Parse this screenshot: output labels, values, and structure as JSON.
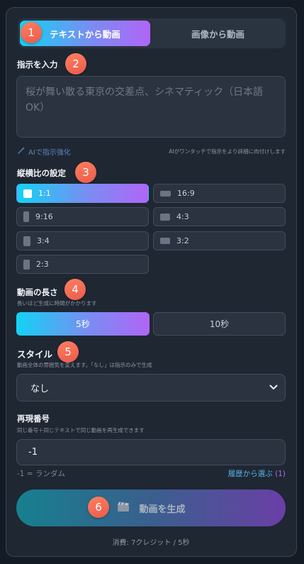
{
  "tabs": [
    {
      "label": "テキストから動画",
      "active": true
    },
    {
      "label": "画像から動画",
      "active": false
    }
  ],
  "badges": [
    "1",
    "2",
    "3",
    "4",
    "5",
    "6"
  ],
  "prompt": {
    "label": "指示を入力",
    "placeholder": "桜が舞い散る東京の交差点、シネマティック（日本語OK）",
    "enhance_label": "AIで指示強化",
    "enhance_note": "AIがワンタッチで指示をより詳細に肉付けします"
  },
  "aspect": {
    "label": "縦横比の設定",
    "options": [
      {
        "label": "1:1",
        "selected": true
      },
      {
        "label": "16:9",
        "selected": false
      },
      {
        "label": "9:16",
        "selected": false
      },
      {
        "label": "4:3",
        "selected": false
      },
      {
        "label": "3:4",
        "selected": false
      },
      {
        "label": "3:2",
        "selected": false
      },
      {
        "label": "2:3",
        "selected": false
      }
    ]
  },
  "duration": {
    "label": "動画の長さ",
    "hint": "長いほど生成に時間がかかります",
    "options": [
      {
        "label": "5秒",
        "selected": true
      },
      {
        "label": "10秒",
        "selected": false
      }
    ]
  },
  "style": {
    "label": "スタイル",
    "hint": "動画全体の雰囲気を変えます。「なし」は指示のみで生成",
    "value": "なし"
  },
  "seed": {
    "label": "再現番号",
    "hint": "同じ番号＋同じテキストで同じ動画を再生成できます",
    "value": "-1",
    "note": "-1 = ランダム",
    "history_label": "履歴から選ぶ",
    "history_count": "(1)"
  },
  "generate": {
    "label": "動画を生成",
    "cost": "消費: 7クレジット / 5秒"
  },
  "colors": {
    "accent_start": "#12d3f4",
    "accent_end": "#b065f7",
    "badge": "#f06a50",
    "panel": "#1f2733",
    "background": "#141b24"
  }
}
